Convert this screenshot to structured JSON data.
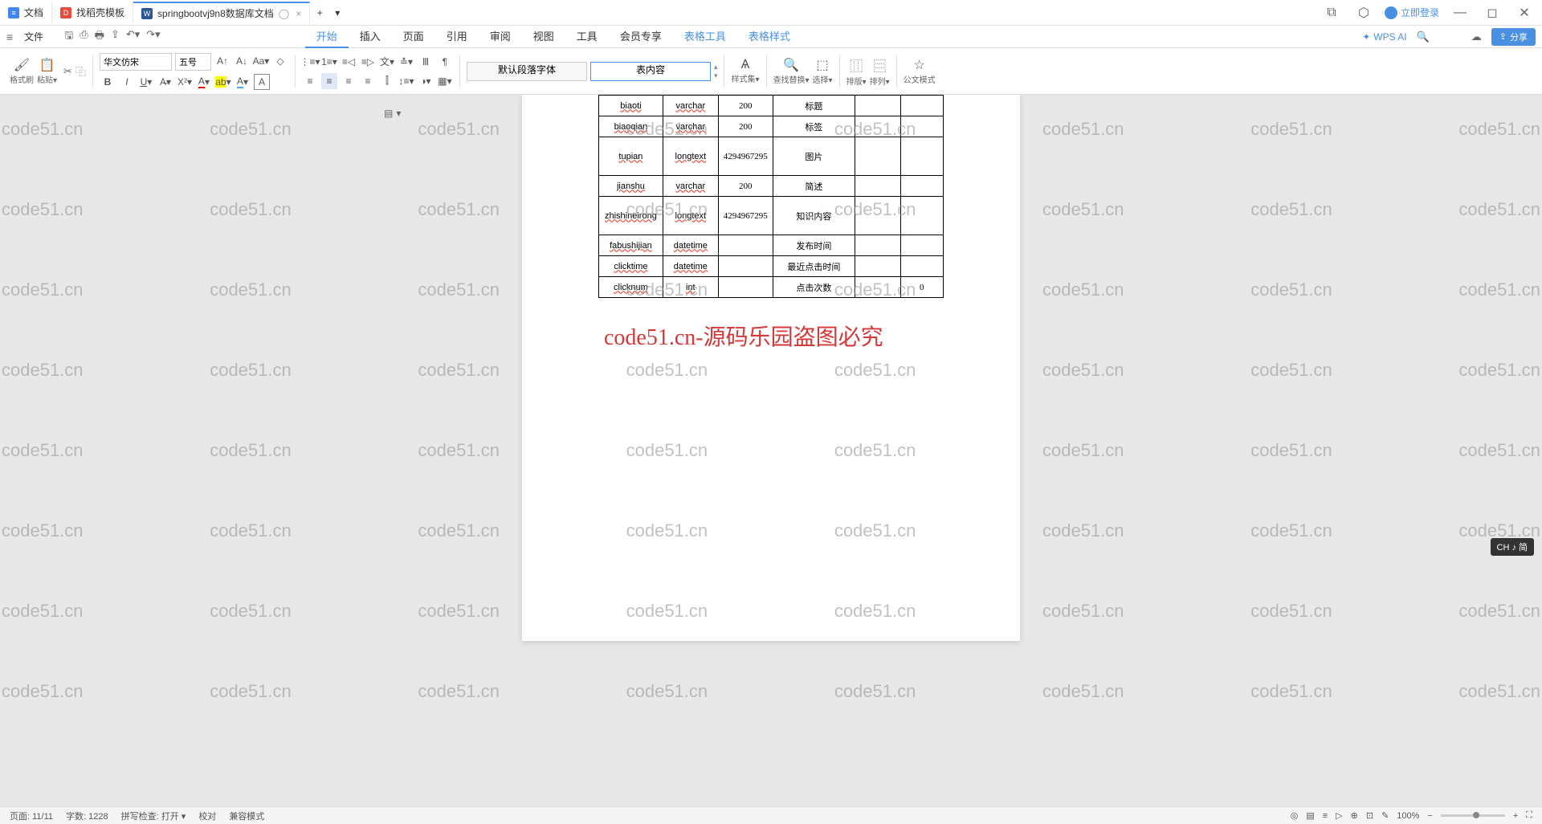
{
  "tabs": [
    {
      "label": "文档",
      "icon": "doc"
    },
    {
      "label": "找稻壳模板",
      "icon": "pdf"
    },
    {
      "label": "springbootvj9n8数据库文档",
      "icon": "word",
      "active": true
    }
  ],
  "login_label": "立即登录",
  "menubar": {
    "file": "文件",
    "tabs": [
      "开始",
      "插入",
      "页面",
      "引用",
      "审阅",
      "视图",
      "工具",
      "会员专享"
    ],
    "extra_tabs": [
      "表格工具",
      "表格样式"
    ],
    "active_tab": "开始",
    "wps_ai": "WPS AI"
  },
  "share_label": "分享",
  "ribbon": {
    "format_brush": "格式刷",
    "paste": "粘贴",
    "font_name": "华文仿宋",
    "font_size": "五号",
    "style_default": "默认段落字体",
    "style_table": "表内容",
    "style_set": "样式集",
    "find_replace": "查找替换",
    "select": "选择",
    "layout": "排版",
    "arrange": "排列",
    "gov_mode": "公文模式"
  },
  "table_rows": [
    {
      "c1": "biaoti",
      "c2": "varchar",
      "c3": "200",
      "c4": "标题",
      "c5": "",
      "c6": ""
    },
    {
      "c1": "biaoqian",
      "c2": "varchar",
      "c3": "200",
      "c4": "标签",
      "c5": "",
      "c6": ""
    },
    {
      "c1": "tupian",
      "c2": "longtext",
      "c3": "4294967295",
      "c4": "图片",
      "c5": "",
      "c6": "",
      "tall": true
    },
    {
      "c1": "jianshu",
      "c2": "varchar",
      "c3": "200",
      "c4": "简述",
      "c5": "",
      "c6": ""
    },
    {
      "c1": "zhishineirong",
      "c2": "longtext",
      "c3": "4294967295",
      "c4": "知识内容",
      "c5": "",
      "c6": "",
      "tall": true
    },
    {
      "c1": "fabushijian",
      "c2": "datetime",
      "c3": "",
      "c4": "发布时间",
      "c5": "",
      "c6": ""
    },
    {
      "c1": "clicktime",
      "c2": "datetime",
      "c3": "",
      "c4": "最近点击时间",
      "c5": "",
      "c6": ""
    },
    {
      "c1": "clicknum",
      "c2": "int",
      "c3": "",
      "c4": "点击次数",
      "c5": "",
      "c6": "0"
    }
  ],
  "watermark_text": "code51.cn",
  "big_watermark": "code51.cn-源码乐园盗图必究",
  "statusbar": {
    "page": "页面: 11/11",
    "words": "字数: 1228",
    "spell": "拼写检查: 打开",
    "proof": "校对",
    "compat": "兼容模式",
    "zoom": "100%"
  },
  "ime": "CH ♪ 简"
}
